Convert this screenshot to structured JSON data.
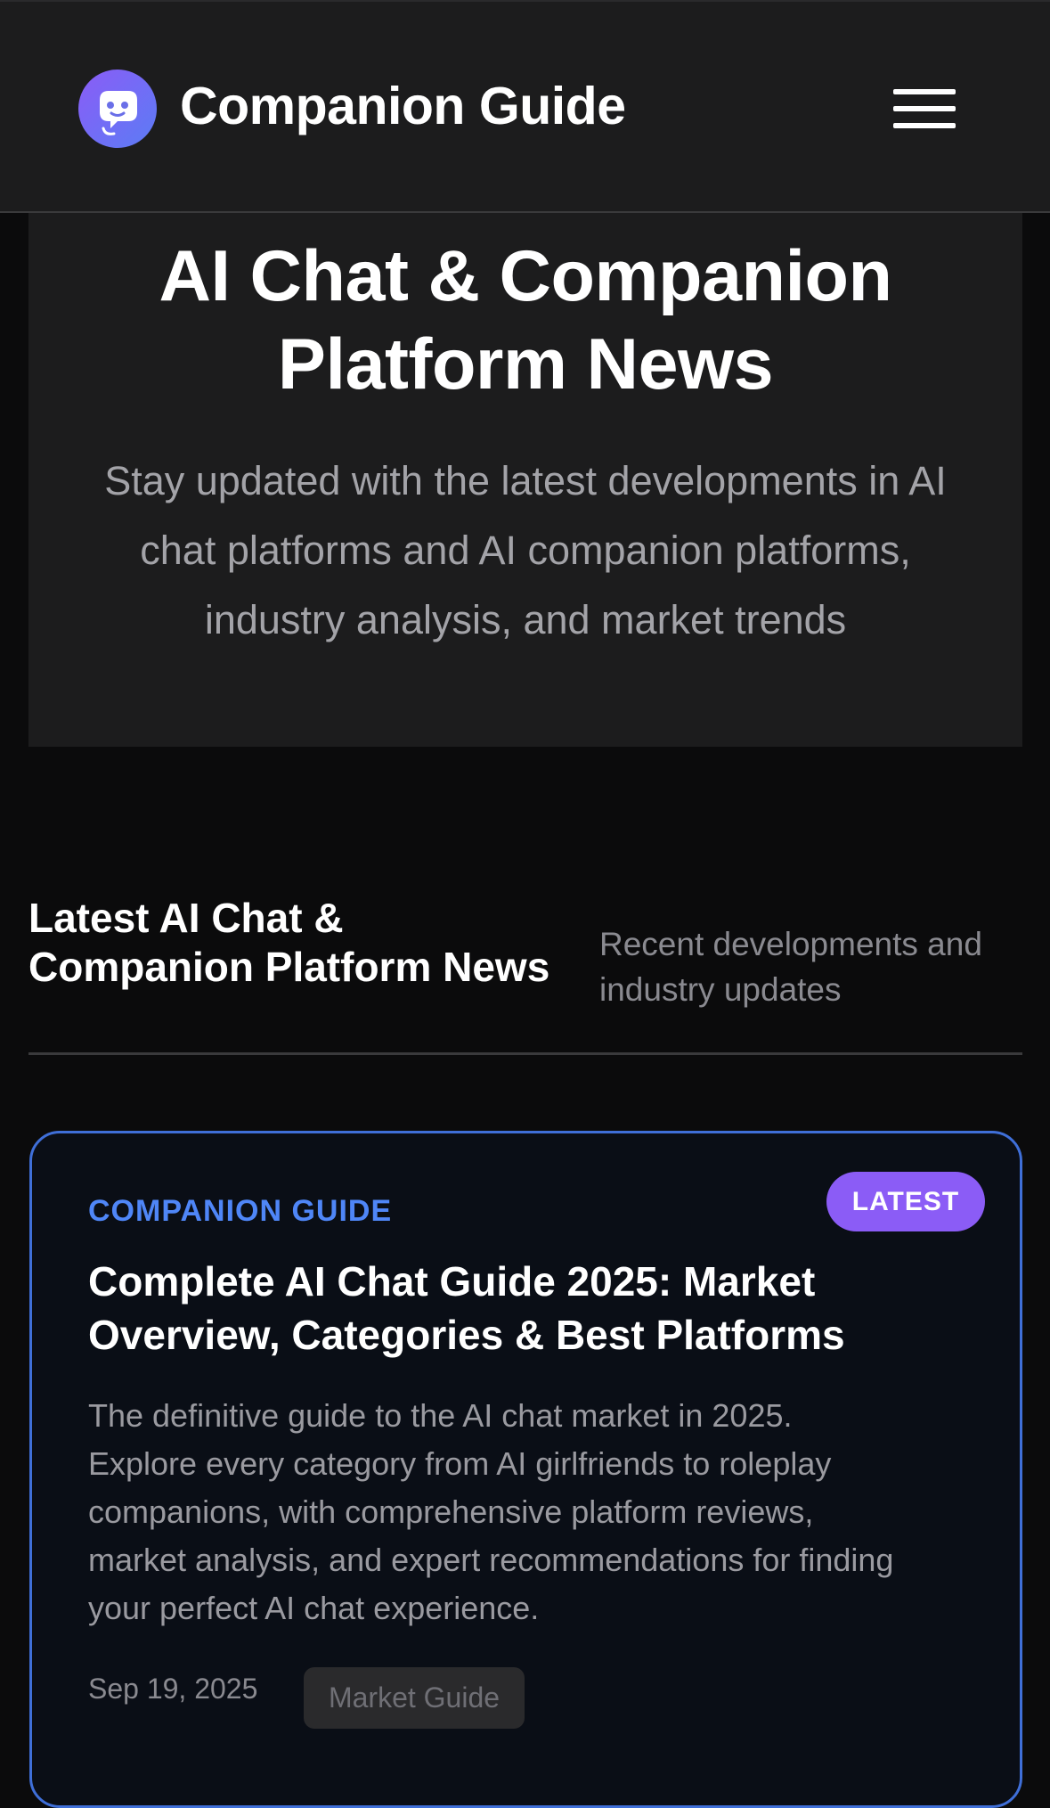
{
  "header": {
    "brand": "Companion Guide",
    "logo_icon": "chat-bubble-icon",
    "menu_icon": "hamburger-menu-icon"
  },
  "hero": {
    "title_line1": "AI Chat & Companion",
    "title_line2": "Platform News",
    "subtitle_line1": "Stay updated with the latest developments in AI",
    "subtitle_line2": "chat platforms and AI companion platforms,",
    "subtitle_line3": "industry analysis, and market trends"
  },
  "section": {
    "title_line1": "Latest AI Chat &",
    "title_line2": "Companion Platform News",
    "subtitle_line1": "Recent developments and",
    "subtitle_line2": "industry updates"
  },
  "articles": [
    {
      "category": "COMPANION GUIDE",
      "badge": "LATEST",
      "title_line1": "Complete AI Chat Guide 2025: Market",
      "title_line2": "Overview, Categories & Best Platforms",
      "excerpt_lines": [
        "The definitive guide to the AI chat market in 2025.",
        "Explore every category from AI girlfriends to roleplay",
        "companions, with comprehensive platform reviews,",
        "market analysis, and expert recommendations for finding",
        "your perfect AI chat experience."
      ],
      "date": "Sep 19, 2025",
      "tag": "Market Guide"
    }
  ],
  "colors": {
    "background": "#0b0b0c",
    "header_bg": "#1c1c1d",
    "accent_blue": "#4f86f7",
    "accent_purple": "#8b5cf6",
    "card_border": "#3f6fd8"
  }
}
